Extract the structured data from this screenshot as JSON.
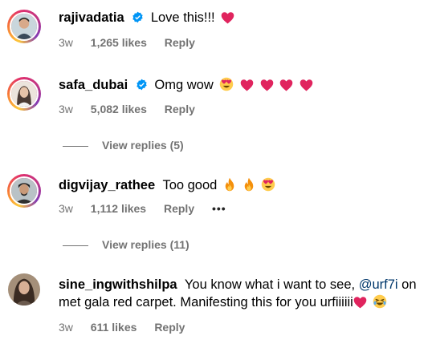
{
  "comments": [
    {
      "username": "rajivadatia",
      "verified": true,
      "text": "Love this!!!",
      "emojis": [
        "heart"
      ],
      "time": "3w",
      "likes": "1,265 likes",
      "reply_label": "Reply"
    },
    {
      "username": "safa_dubai",
      "verified": true,
      "text": "Omg wow",
      "emojis": [
        "heart-eyes",
        "heart",
        "heart",
        "heart",
        "heart"
      ],
      "time": "3w",
      "likes": "5,082 likes",
      "reply_label": "Reply",
      "view_replies": "View replies (5)"
    },
    {
      "username": "digvijay_rathee",
      "verified": false,
      "text": "Too good",
      "emojis": [
        "fire",
        "fire",
        "heart-eyes"
      ],
      "time": "3w",
      "likes": "1,112 likes",
      "reply_label": "Reply",
      "more": "•••",
      "view_replies": "View replies (11)"
    },
    {
      "username": "sine_ingwithshilpa",
      "verified": false,
      "text_before": "You know what i want to see,",
      "mention": "@urf7i",
      "text_after": "on met gala red carpet. Manifesting this for you urfiiiiii",
      "emojis": [
        "heart",
        "laughing"
      ],
      "time": "3w",
      "likes": "611 likes",
      "reply_label": "Reply"
    }
  ],
  "colors": {
    "heart": "#e0245e",
    "verified": "#0095f6",
    "mention": "#00376b",
    "meta": "#737373"
  }
}
